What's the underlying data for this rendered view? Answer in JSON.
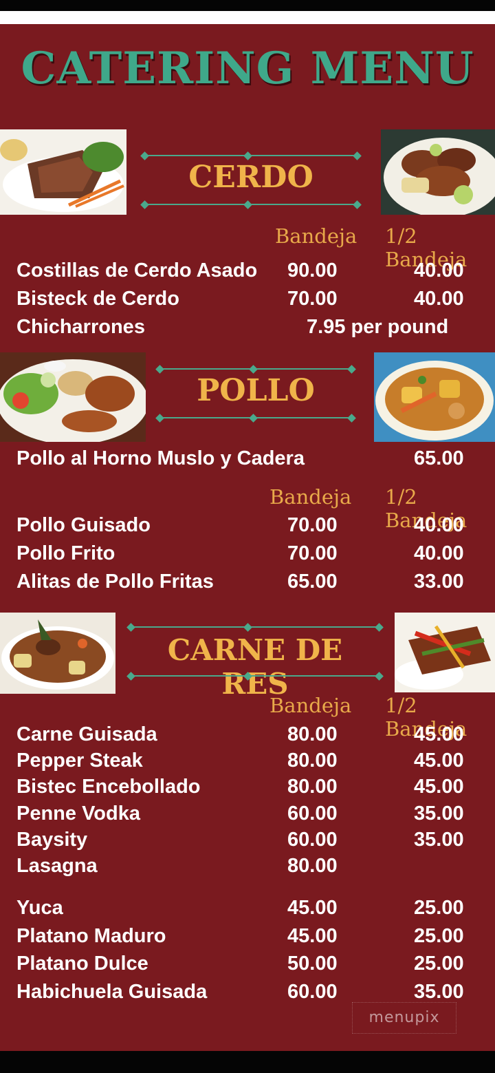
{
  "title": "CATERING MENU",
  "colors": {
    "background": "#7a1a1f",
    "title": "#3fa88a",
    "section": "#f0b44a",
    "column_header": "#e8a94a",
    "divider": "#4aa98c"
  },
  "columns": {
    "full": "Bandeja",
    "half": "1/2 Bandeja"
  },
  "cerdo": {
    "title": "CERDO",
    "items": [
      {
        "name": "Costillas de Cerdo Asado",
        "full": "90.00",
        "half": "40.00"
      },
      {
        "name": "Bisteck de Cerdo",
        "full": "70.00",
        "half": "40.00"
      }
    ],
    "chicharrones": {
      "name": "Chicharrones",
      "price": "7.95 per pound"
    }
  },
  "pollo": {
    "title": "POLLO",
    "horno": {
      "name": "Pollo al Horno Muslo y Cadera",
      "price": "65.00"
    },
    "items": [
      {
        "name": "Pollo Guisado",
        "full": "70.00",
        "half": "40.00"
      },
      {
        "name": "Pollo Frito",
        "full": "70.00",
        "half": "40.00"
      },
      {
        "name": "Alitas de Pollo Fritas",
        "full": "65.00",
        "half": "33.00"
      }
    ]
  },
  "res": {
    "title": "CARNE DE RES",
    "items": [
      {
        "name": "Carne Guisada",
        "full": "80.00",
        "half": "45.00"
      },
      {
        "name": "Pepper Steak",
        "full": "80.00",
        "half": "45.00"
      },
      {
        "name": "Bistec Encebollado",
        "full": "80.00",
        "half": "45.00"
      },
      {
        "name": "Penne Vodka",
        "full": "60.00",
        "half": "35.00"
      },
      {
        "name": "Baysity",
        "full": "60.00",
        "half": "35.00"
      },
      {
        "name": "Lasagna",
        "full": "80.00",
        "half": ""
      }
    ]
  },
  "sides": {
    "items": [
      {
        "name": "Yuca",
        "full": "45.00",
        "half": "25.00"
      },
      {
        "name": "Platano Maduro",
        "full": "45.00",
        "half": "25.00"
      },
      {
        "name": "Platano Dulce",
        "full": "50.00",
        "half": "25.00"
      },
      {
        "name": "Habichuela Guisada",
        "full": "60.00",
        "half": "35.00"
      }
    ]
  },
  "watermark": "menupix"
}
